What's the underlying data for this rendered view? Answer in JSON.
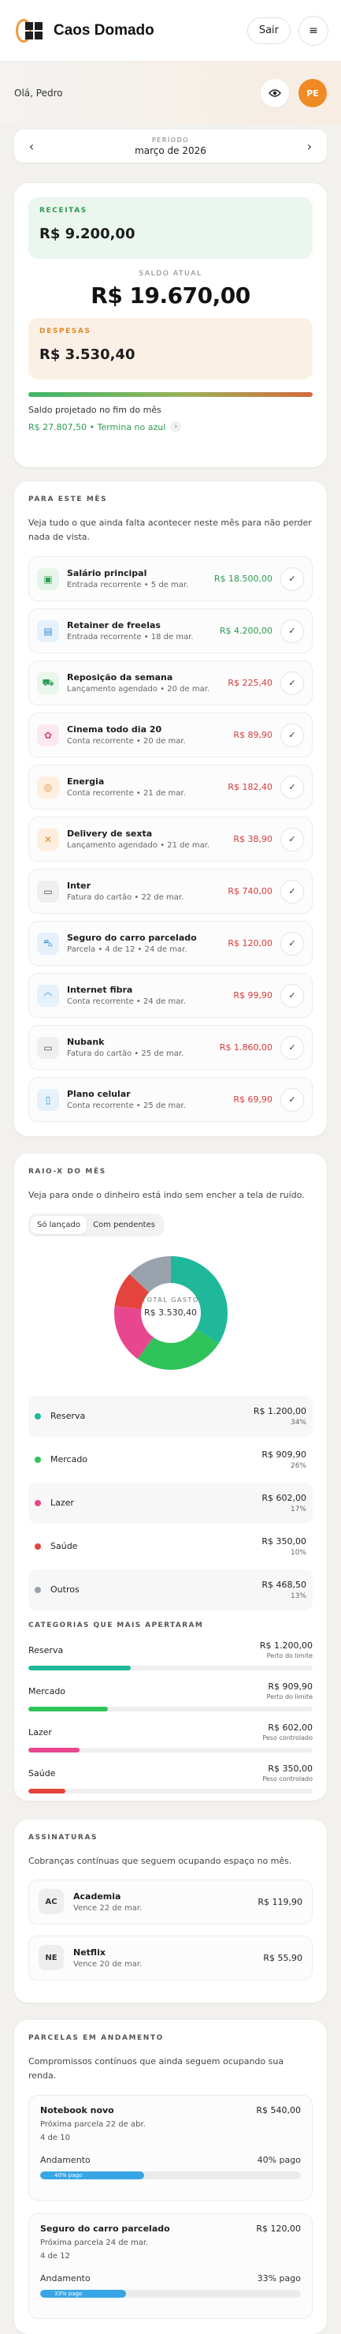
{
  "app": {
    "title": "Caos Domado",
    "logout_label": "Sair",
    "menu_icon": "menu-icon",
    "avatar_initials": "PE",
    "accent": "#f08a24"
  },
  "greeting": "Olá, Pedro",
  "period": {
    "label": "PERÍODO",
    "value": "março de 2026"
  },
  "summary": {
    "receitas_label": "RECEITAS",
    "receitas_value": "R$ 9.200,00",
    "saldo_label": "SALDO ATUAL",
    "saldo_value": "R$ 19.670,00",
    "despesas_label": "DESPESAS",
    "despesas_value": "R$ 3.530,40",
    "projection_label": "Saldo projetado no fim do mês",
    "projection_value": "R$ 27.807,50 • Termina no azul"
  },
  "month": {
    "title": "PARA ESTE MÊS",
    "description": "Veja tudo o que ainda falta acontecer neste mês para não perder nada de vista.",
    "items": [
      {
        "name": "Salário principal",
        "sub": "Entrada recorrente • 5 de mar.",
        "amount": "R$ 18.500,00",
        "kind": "pos",
        "icon": "briefcase-icon",
        "glyph": "▣",
        "bg": "#e6f5ea",
        "fg": "#2c9c52"
      },
      {
        "name": "Retainer de freelas",
        "sub": "Entrada recorrente • 18 de mar.",
        "amount": "R$ 4.200,00",
        "kind": "pos",
        "icon": "wallet-icon",
        "glyph": "▤",
        "bg": "#e6f1fb",
        "fg": "#3a8fd6"
      },
      {
        "name": "Reposição da semana",
        "sub": "Lançamento agendado • 20 de mar.",
        "amount": "R$ 225,40",
        "kind": "neg",
        "icon": "cart-icon",
        "glyph": "⛟",
        "bg": "#e8f6ec",
        "fg": "#2c9c52"
      },
      {
        "name": "Cinema todo dia 20",
        "sub": "Conta recorrente • 20 de mar.",
        "amount": "R$ 89,90",
        "kind": "neg",
        "icon": "gift-icon",
        "glyph": "✿",
        "bg": "#fbe9ef",
        "fg": "#d9477a"
      },
      {
        "name": "Energia",
        "sub": "Conta recorrente • 21 de mar.",
        "amount": "R$ 182,40",
        "kind": "neg",
        "icon": "target-icon",
        "glyph": "◎",
        "bg": "#fdeedd",
        "fg": "#e08a2b"
      },
      {
        "name": "Delivery de sexta",
        "sub": "Lançamento agendado • 21 de mar.",
        "amount": "R$ 38,90",
        "kind": "neg",
        "icon": "utensils-icon",
        "glyph": "✕",
        "bg": "#fdeedd",
        "fg": "#e08a2b"
      },
      {
        "name": "Inter",
        "sub": "Fatura do cartão • 22 de mar.",
        "amount": "R$ 740,00",
        "kind": "neg",
        "icon": "credit-card-icon",
        "glyph": "▭",
        "bg": "#efefef",
        "fg": "#555"
      },
      {
        "name": "Seguro do carro parcelado",
        "sub": "Parcela • 4 de 12 • 24 de mar.",
        "amount": "R$ 120,00",
        "kind": "neg",
        "icon": "car-icon",
        "glyph": "⛍",
        "bg": "#e6f1fb",
        "fg": "#3a8fd6"
      },
      {
        "name": "Internet fibra",
        "sub": "Conta recorrente • 24 de mar.",
        "amount": "R$ 99,90",
        "kind": "neg",
        "icon": "wifi-icon",
        "glyph": "◠",
        "bg": "#e6f1fb",
        "fg": "#3a8fd6"
      },
      {
        "name": "Nubank",
        "sub": "Fatura do cartão • 25 de mar.",
        "amount": "R$ 1.860,00",
        "kind": "neg",
        "icon": "credit-card-icon",
        "glyph": "▭",
        "bg": "#efefef",
        "fg": "#555"
      },
      {
        "name": "Plano celular",
        "sub": "Conta recorrente • 25 de mar.",
        "amount": "R$ 69,90",
        "kind": "neg",
        "icon": "phone-icon",
        "glyph": "▯",
        "bg": "#e6f1fb",
        "fg": "#3a8fd6"
      }
    ]
  },
  "raio": {
    "title": "RAIO-X DO MÊS",
    "description": "Veja para onde o dinheiro está indo sem encher a tela de ruído.",
    "filters": [
      "Só lançado",
      "Com pendentes"
    ],
    "total_label": "TOTAL GASTO",
    "total_value": "R$ 3.530,40",
    "breakdown": [
      {
        "name": "Reserva",
        "amount": "R$ 1.200,00",
        "pct": "34%",
        "value": 34,
        "color": "#1fb89a"
      },
      {
        "name": "Mercado",
        "amount": "R$ 909,90",
        "pct": "26%",
        "value": 26,
        "color": "#2fc35a"
      },
      {
        "name": "Lazer",
        "amount": "R$ 602,00",
        "pct": "17%",
        "value": 17,
        "color": "#e8468e"
      },
      {
        "name": "Saúde",
        "amount": "R$ 350,00",
        "pct": "10%",
        "value": 10,
        "color": "#e5433d"
      },
      {
        "name": "Outros",
        "amount": "R$ 468,50",
        "pct": "13%",
        "value": 13,
        "color": "#9aa3ad"
      }
    ],
    "categories_title": "CATEGORIAS QUE MAIS APERTARAM",
    "categories": [
      {
        "name": "Reserva",
        "amount": "R$ 1.200,00",
        "note": "Perto do limite",
        "fill": 0.36,
        "color": "#1fb89a"
      },
      {
        "name": "Mercado",
        "amount": "R$ 909,90",
        "note": "Perto do limite",
        "fill": 0.28,
        "color": "#2fc35a"
      },
      {
        "name": "Lazer",
        "amount": "R$ 602,00",
        "note": "Peso controlado",
        "fill": 0.18,
        "color": "#e8468e"
      },
      {
        "name": "Saúde",
        "amount": "R$ 350,00",
        "note": "Peso controlado",
        "fill": 0.13,
        "color": "#e5433d"
      }
    ]
  },
  "subscriptions": {
    "title": "ASSINATURAS",
    "description": "Cobranças contínuas que seguem ocupando espaço no mês.",
    "items": [
      {
        "abbr": "AC",
        "name": "Academia",
        "due": "Vence 22 de mar.",
        "amount": "R$ 119,90"
      },
      {
        "abbr": "NE",
        "name": "Netflix",
        "due": "Vence 20 de mar.",
        "amount": "R$ 55,90"
      }
    ]
  },
  "installments": {
    "title": "PARCELAS EM ANDAMENTO",
    "description": "Compromissos contínuos que ainda seguem ocupando sua renda.",
    "items": [
      {
        "name": "Notebook novo",
        "amount": "R$ 540,00",
        "next": "Próxima parcela 22 de abr.",
        "count": "4 de 10",
        "progress_label": "Andamento",
        "paid_label": "40% pago",
        "bar_label": "40% pago",
        "progress": 0.4
      },
      {
        "name": "Seguro do carro parcelado",
        "amount": "R$ 120,00",
        "next": "Próxima parcela 24 de mar.",
        "count": "4 de 12",
        "progress_label": "Andamento",
        "paid_label": "33% pago",
        "bar_label": "33% pago",
        "progress": 0.33
      }
    ]
  }
}
